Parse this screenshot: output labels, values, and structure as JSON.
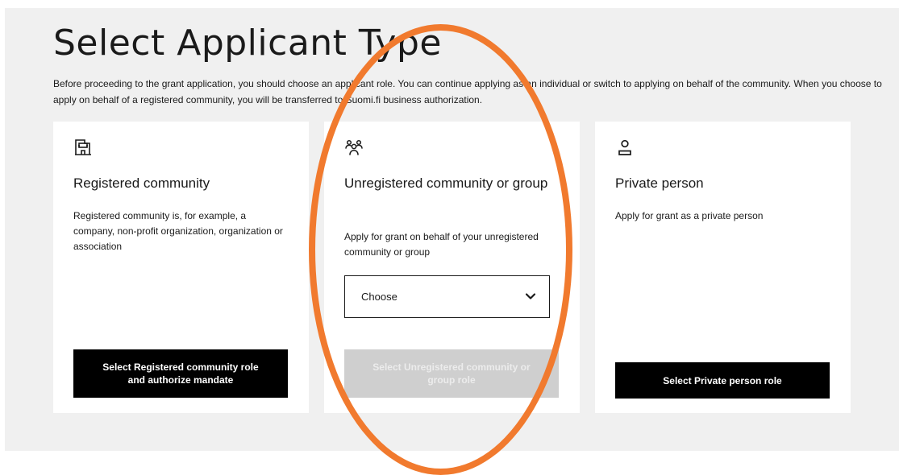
{
  "page": {
    "title": "Select Applicant Type",
    "intro": "Before proceeding to the grant application, you should choose an applicant role. You can continue applying as an individual or switch to applying on behalf of the community. When you choose to apply on behalf of a registered community, you will be transferred to Suomi.fi business authorization."
  },
  "cards": [
    {
      "icon": "building-icon",
      "title": "Registered community",
      "description": "Registered community is, for example, a company, non-profit organization, organization or association",
      "button_label": "Select Registered community role and authorize mandate",
      "button_enabled": true
    },
    {
      "icon": "group-icon",
      "title": "Unregistered community or group",
      "description": "Apply for grant on behalf of your unregistered community or group",
      "select_value": "Choose",
      "select_icon": "chevron-down-icon",
      "button_label": "Select Unregistered community or group role",
      "button_enabled": false
    },
    {
      "icon": "person-icon",
      "title": "Private person",
      "description": "Apply for grant as a private person",
      "button_label": "Select Private person role",
      "button_enabled": true
    }
  ],
  "annotation": {
    "shape": "ellipse",
    "color": "#f17a2e"
  },
  "colors": {
    "background": "#f0f0f0",
    "card": "#ffffff",
    "button": "#000000",
    "button_disabled": "#cfcfcf"
  }
}
